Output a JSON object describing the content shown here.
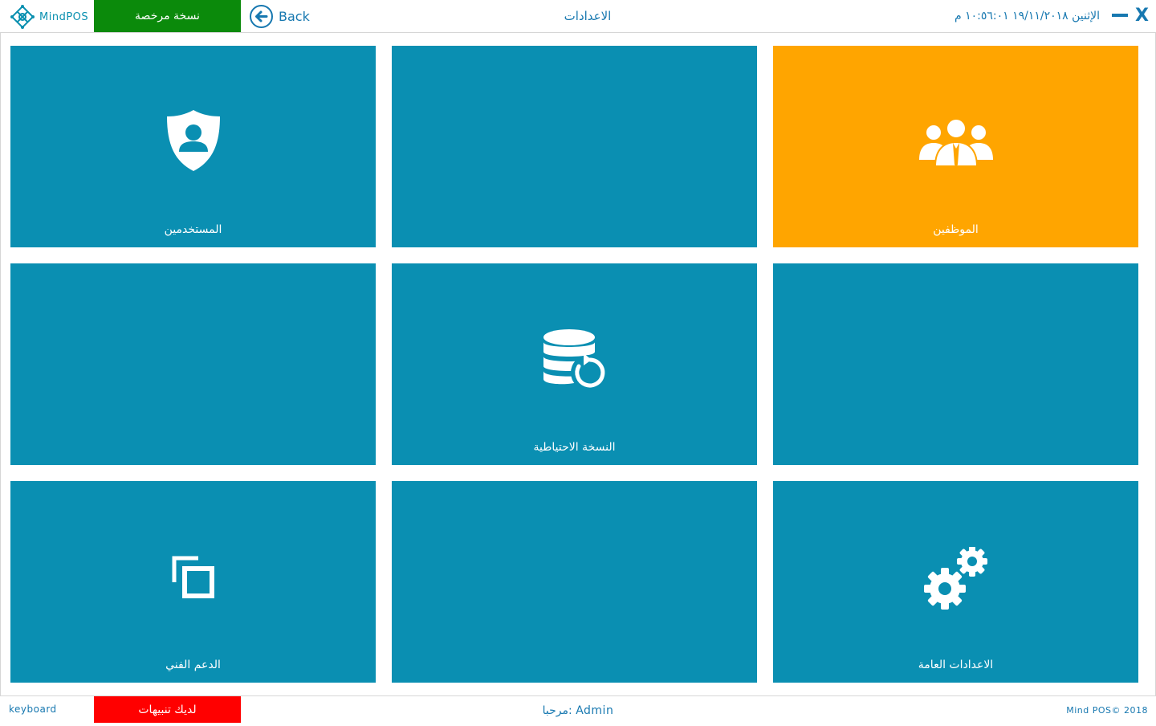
{
  "header": {
    "logo_text": "MindPOS",
    "license_badge": "نسخة مرخصة",
    "back_label": "Back",
    "page_title": "الاعدادات",
    "datetime": "الإثنين ١٩/١١/٢٠١٨ ١٠:٥٦:٠١ م",
    "close_label": "X"
  },
  "tiles": [
    {
      "label": "الموظفين",
      "icon": "employees-icon",
      "color": "#ffa500"
    },
    {
      "label": "",
      "icon": "",
      "color": "#0a8fb2"
    },
    {
      "label": "المستخدمين",
      "icon": "user-shield-icon",
      "color": "#0a8fb2"
    },
    {
      "label": "",
      "icon": "",
      "color": "#0a8fb2"
    },
    {
      "label": "النسخة الاحتياطية",
      "icon": "database-backup-icon",
      "color": "#0a8fb2"
    },
    {
      "label": "",
      "icon": "",
      "color": "#0a8fb2"
    },
    {
      "label": "الاعدادات العامة",
      "icon": "gears-icon",
      "color": "#0a8fb2"
    },
    {
      "label": "",
      "icon": "",
      "color": "#0a8fb2"
    },
    {
      "label": "الدعم الفني",
      "icon": "remote-windows-icon",
      "color": "#0a8fb2"
    }
  ],
  "footer": {
    "keyboard_label": "keyboard",
    "alerts_label": "لديك تنبيهات",
    "welcome_text": "مرحبا: Admin",
    "copyright": "Mind POS© 2018"
  },
  "colors": {
    "accent": "#1778b0",
    "tile": "#0a8fb2",
    "tile_highlight": "#ffa500",
    "license": "#0b8a0b",
    "alert": "#ff0000"
  }
}
